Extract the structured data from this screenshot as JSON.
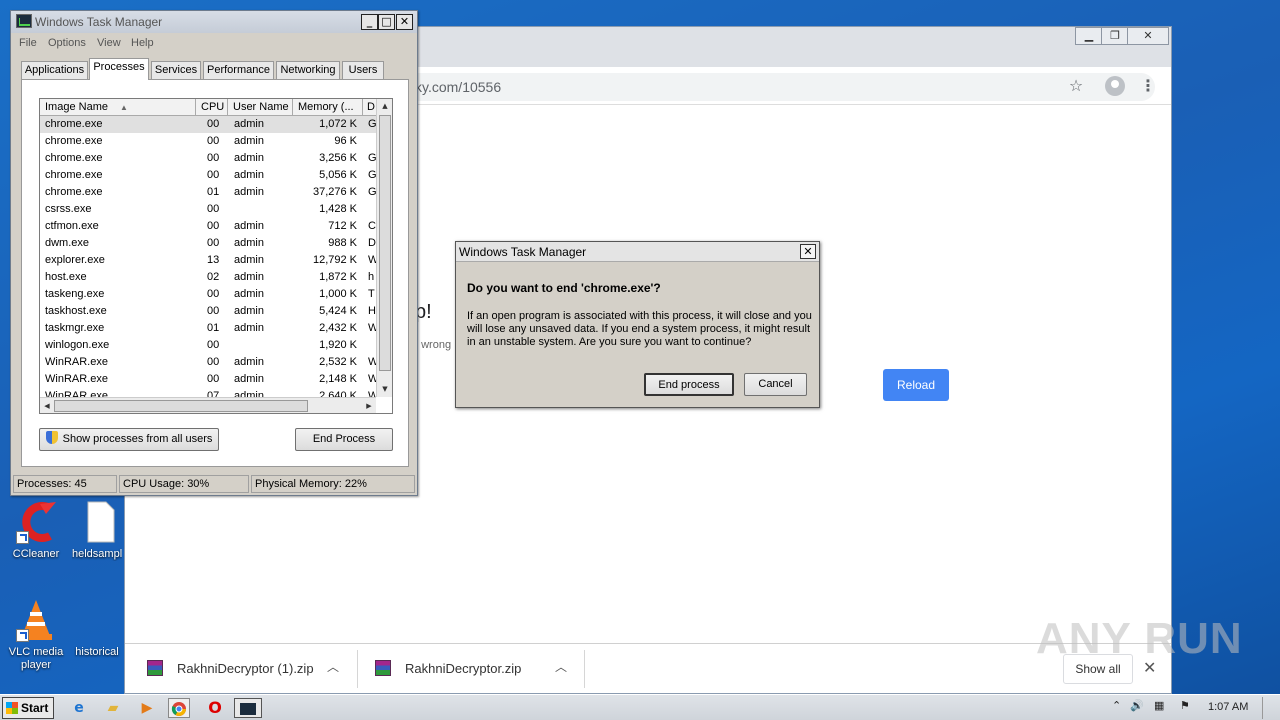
{
  "desktop": {
    "icons": [
      {
        "label": "CCleaner"
      },
      {
        "label": "heldsampl"
      },
      {
        "label": "VLC media player"
      },
      {
        "label": "historical"
      }
    ]
  },
  "chrome": {
    "url": "ky.com/10556",
    "page_fragments": {
      "heading": "p!",
      "subtext": "t wrong"
    },
    "reload_label": "Reload",
    "downloads": [
      {
        "name": "RakhniDecryptor (1).zip"
      },
      {
        "name": "RakhniDecryptor.zip"
      }
    ],
    "show_all": "Show all"
  },
  "watermark": "ANY RUN",
  "task_manager": {
    "title": "Windows Task Manager",
    "menu": [
      "File",
      "Options",
      "View",
      "Help"
    ],
    "tabs": [
      "Applications",
      "Processes",
      "Services",
      "Performance",
      "Networking",
      "Users"
    ],
    "active_tab": "Processes",
    "columns": [
      "Image Name",
      "CPU",
      "User Name",
      "Memory (...",
      "D"
    ],
    "rows": [
      {
        "name": "chrome.exe",
        "cpu": "00",
        "user": "admin",
        "mem": "1,072 K",
        "desc": "G"
      },
      {
        "name": "chrome.exe",
        "cpu": "00",
        "user": "admin",
        "mem": "96 K",
        "desc": ""
      },
      {
        "name": "chrome.exe",
        "cpu": "00",
        "user": "admin",
        "mem": "3,256 K",
        "desc": "G"
      },
      {
        "name": "chrome.exe",
        "cpu": "00",
        "user": "admin",
        "mem": "5,056 K",
        "desc": "G"
      },
      {
        "name": "chrome.exe",
        "cpu": "01",
        "user": "admin",
        "mem": "37,276 K",
        "desc": "G"
      },
      {
        "name": "csrss.exe",
        "cpu": "00",
        "user": "",
        "mem": "1,428 K",
        "desc": ""
      },
      {
        "name": "ctfmon.exe",
        "cpu": "00",
        "user": "admin",
        "mem": "712 K",
        "desc": "C"
      },
      {
        "name": "dwm.exe",
        "cpu": "00",
        "user": "admin",
        "mem": "988 K",
        "desc": "D"
      },
      {
        "name": "explorer.exe",
        "cpu": "13",
        "user": "admin",
        "mem": "12,792 K",
        "desc": "W"
      },
      {
        "name": "host.exe",
        "cpu": "02",
        "user": "admin",
        "mem": "1,872 K",
        "desc": "h"
      },
      {
        "name": "taskeng.exe",
        "cpu": "00",
        "user": "admin",
        "mem": "1,000 K",
        "desc": "T"
      },
      {
        "name": "taskhost.exe",
        "cpu": "00",
        "user": "admin",
        "mem": "5,424 K",
        "desc": "H"
      },
      {
        "name": "taskmgr.exe",
        "cpu": "01",
        "user": "admin",
        "mem": "2,432 K",
        "desc": "W"
      },
      {
        "name": "winlogon.exe",
        "cpu": "00",
        "user": "",
        "mem": "1,920 K",
        "desc": ""
      },
      {
        "name": "WinRAR.exe",
        "cpu": "00",
        "user": "admin",
        "mem": "2,532 K",
        "desc": "W"
      },
      {
        "name": "WinRAR.exe",
        "cpu": "00",
        "user": "admin",
        "mem": "2,148 K",
        "desc": "W"
      },
      {
        "name": "WinRAR.exe",
        "cpu": "07",
        "user": "admin",
        "mem": "2,640 K",
        "desc": "W"
      }
    ],
    "show_all_label": "Show processes from all users",
    "end_process_label": "End Process",
    "status": {
      "processes": "Processes: 45",
      "cpu": "CPU Usage: 30%",
      "memory": "Physical Memory: 22%"
    }
  },
  "dialog": {
    "title": "Windows Task Manager",
    "question": "Do you want to end 'chrome.exe'?",
    "message": "If an open program is associated with this process, it will close and you will lose any unsaved data. If you end a system process, it might result in an unstable system. Are you sure you want to continue?",
    "confirm_label": "End process",
    "cancel_label": "Cancel"
  },
  "taskbar": {
    "start_label": "Start",
    "clock": "1:07 AM"
  }
}
